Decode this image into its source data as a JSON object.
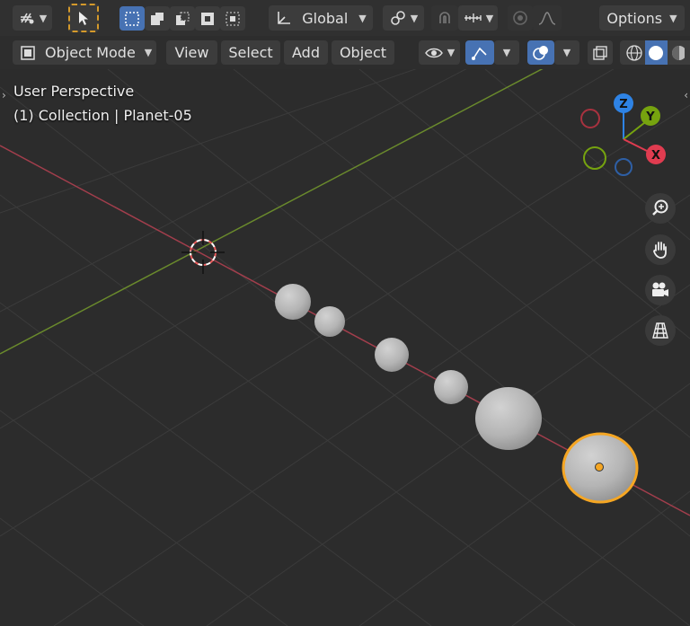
{
  "header": {
    "transform_orientation": "Global",
    "options_label": "Options",
    "mode_label": "Object Mode",
    "menus": [
      "View",
      "Select",
      "Add",
      "Object"
    ]
  },
  "viewport": {
    "perspective_label": "User Perspective",
    "collection_label": "(1) Collection | Planet-05"
  },
  "gizmo": {
    "z_label": "Z",
    "y_label": "Y",
    "x_label": "X",
    "colors": {
      "x": "#e03c50",
      "y": "#76a30f",
      "z": "#2e83e5",
      "selection": "#f5a623",
      "x_axis_line": "#a23e4c",
      "y_axis_line": "#6a8a2c"
    }
  },
  "icons": {
    "editor_type": "editor-type-icon",
    "select": "select-cursor-icon",
    "zoom": "zoom-icon",
    "pan": "hand-pan-icon",
    "camera": "camera-icon",
    "ortho": "grid-perspective-icon"
  }
}
